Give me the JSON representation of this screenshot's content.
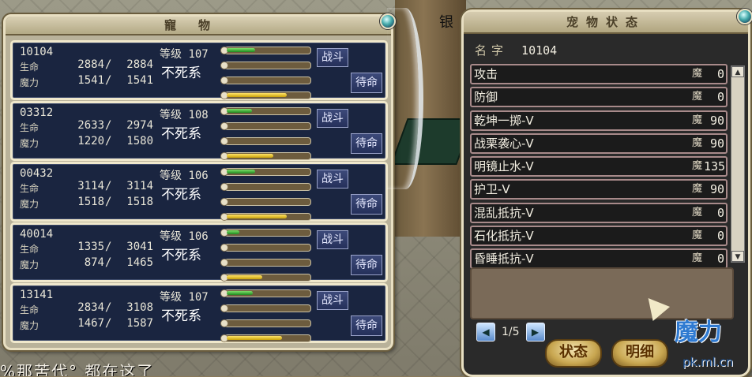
{
  "background": {
    "bank_text": "银",
    "caption": "%那苦代° 都在这了"
  },
  "pet_window": {
    "title": "寵物",
    "battle_label": "战斗",
    "standby_label": "待命",
    "level_label": "等级",
    "hp_label": "生命",
    "mp_label": "魔力",
    "pets": [
      {
        "id": "10104",
        "level": "107",
        "hp_cur": "2884",
        "hp_max": "2884",
        "mp_cur": "1541",
        "mp_max": "1541",
        "race": "不死系",
        "hp_fraction": 1.0,
        "mp_fraction": 1.0
      },
      {
        "id": "03312",
        "level": "108",
        "hp_cur": "2633",
        "hp_max": "2974",
        "mp_cur": "1220",
        "mp_max": "1580",
        "race": "不死系",
        "hp_fraction": 0.885,
        "mp_fraction": 0.772
      },
      {
        "id": "00432",
        "level": "106",
        "hp_cur": "3114",
        "hp_max": "3114",
        "mp_cur": "1518",
        "mp_max": "1518",
        "race": "不死系",
        "hp_fraction": 1.0,
        "mp_fraction": 1.0
      },
      {
        "id": "40014",
        "level": "106",
        "hp_cur": "1335",
        "hp_max": "3041",
        "mp_cur": "874",
        "mp_max": "1465",
        "race": "不死系",
        "hp_fraction": 0.439,
        "mp_fraction": 0.597
      },
      {
        "id": "13141",
        "level": "107",
        "hp_cur": "2834",
        "hp_max": "3108",
        "mp_cur": "1467",
        "mp_max": "1587",
        "race": "不死系",
        "hp_fraction": 0.912,
        "mp_fraction": 0.924
      }
    ]
  },
  "status_window": {
    "title": "宠物状态",
    "name_label": "名字",
    "name_value": "10104",
    "skill_unit": "魔",
    "skills": [
      {
        "name": "攻击",
        "cost": "0"
      },
      {
        "name": "防御",
        "cost": "0"
      },
      {
        "name": "乾坤一掷-V",
        "cost": "90"
      },
      {
        "name": "战栗袭心-V",
        "cost": "90"
      },
      {
        "name": "明镜止水-V",
        "cost": "135"
      },
      {
        "name": "护卫-V",
        "cost": "90"
      },
      {
        "name": "混乱抵抗-V",
        "cost": "0"
      },
      {
        "name": "石化抵抗-V",
        "cost": "0"
      },
      {
        "name": "昏睡抵抗-V",
        "cost": "0"
      }
    ],
    "page": "1/5",
    "status_button": "状态",
    "detail_button": "明细"
  },
  "watermark": {
    "logo_main": "魔力",
    "logo_sub": "pk.ml.cn"
  },
  "colors": {
    "card_bg": "#1a2540",
    "hp_bar": "#1e8a1e",
    "mp_bar": "#c9a20a",
    "frame": "#e8dfc2"
  }
}
